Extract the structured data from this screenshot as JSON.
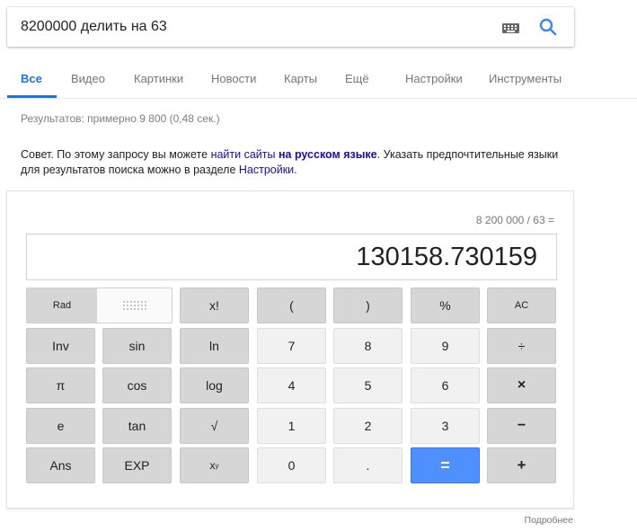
{
  "search": {
    "query": "8200000 делить на 63"
  },
  "tabs": [
    "Все",
    "Видео",
    "Картинки",
    "Новости",
    "Карты",
    "Ещё",
    "Настройки",
    "Инструменты"
  ],
  "stats": "Результатов: примерно 9 800 (0,48 сек.)",
  "tip": {
    "prefix": "Совет. По этому запросу вы можете ",
    "link1": "найти сайты",
    "link2": "на русском языке",
    "middle": ". Указать предпочтительные языки для результатов поиска можно в разделе ",
    "link3": "Настройки",
    "suffix": "."
  },
  "calculator": {
    "expression": "8 200 000 / 63 =",
    "result": "130158.730159",
    "rad_label": "Rad",
    "keys": [
      [
        "x!",
        "(",
        ")",
        "%",
        "AC"
      ],
      [
        "Inv",
        "sin",
        "ln",
        "7",
        "8",
        "9",
        "÷"
      ],
      [
        "π",
        "cos",
        "log",
        "4",
        "5",
        "6",
        "×"
      ],
      [
        "e",
        "tan",
        "√",
        "1",
        "2",
        "3",
        "−"
      ],
      [
        "Ans",
        "EXP",
        "x",
        "0",
        ".",
        "=",
        "+"
      ]
    ],
    "power_sup": "y"
  },
  "footer": {
    "more": "Подробнее"
  },
  "colors": {
    "accent": "#1a73e8",
    "link": "#1a0dab",
    "equals": "#4d90fe"
  }
}
